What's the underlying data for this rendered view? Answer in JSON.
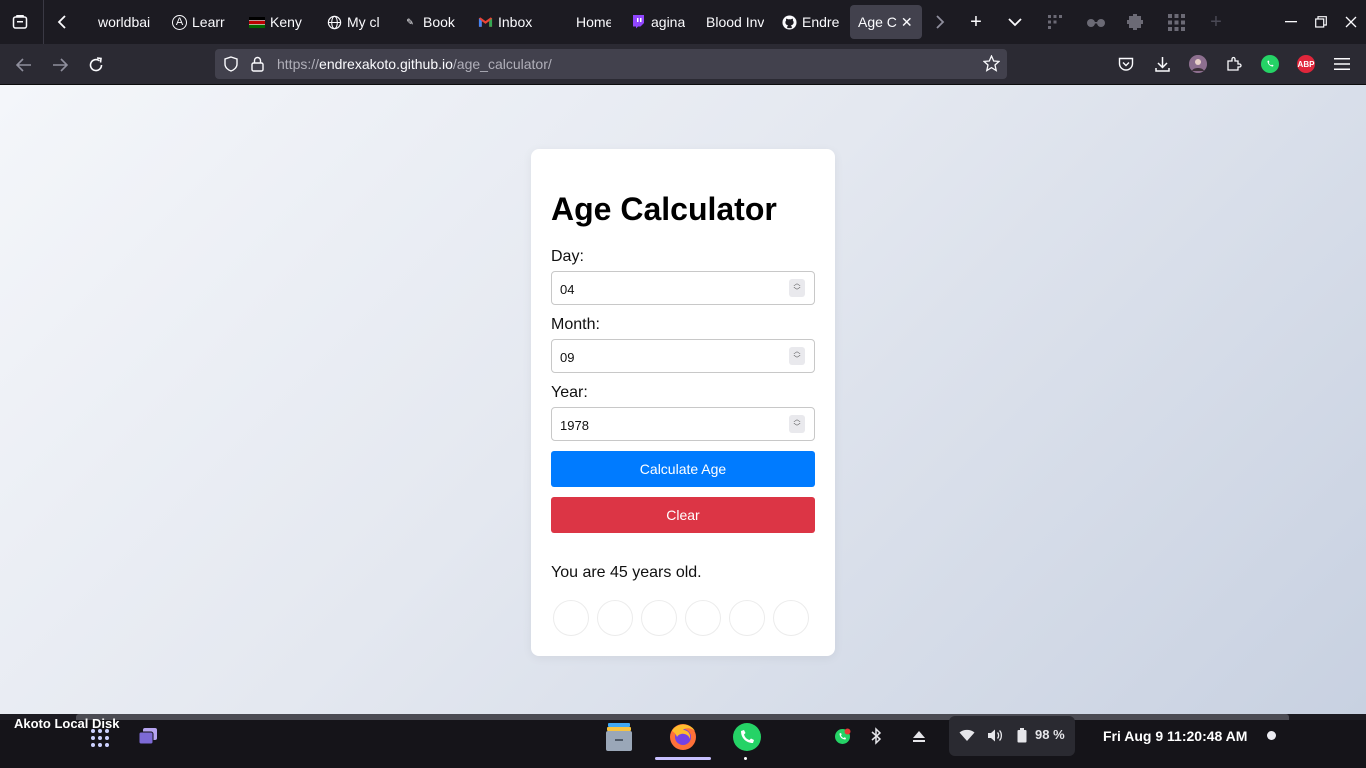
{
  "browser": {
    "tabs": [
      {
        "label": "worldbai",
        "icon": "globe-icon"
      },
      {
        "label": "Learr",
        "icon": "learn-icon"
      },
      {
        "label": "Keny",
        "icon": "kenya-flag-icon"
      },
      {
        "label": "My cl",
        "icon": "globe-icon"
      },
      {
        "label": "Book",
        "icon": "book-icon"
      },
      {
        "label": "Inbox",
        "icon": "gmail-icon"
      },
      {
        "label": "Home",
        "icon": "home-icon"
      },
      {
        "label": "agina",
        "icon": "twitch-icon"
      },
      {
        "label": "Blood Inv",
        "icon": "blood-icon"
      },
      {
        "label": "Endre",
        "icon": "github-icon"
      }
    ],
    "active_tab": {
      "label": "Age C"
    },
    "url_prefix": "https://",
    "url_domain": "endrexakoto.github.io",
    "url_path": "/age_calculator/",
    "extensions": {
      "adblock_label": "ABP"
    }
  },
  "page": {
    "title": "Age Calculator",
    "day_label": "Day:",
    "day_value": "04",
    "month_label": "Month:",
    "month_value": "09",
    "year_label": "Year:",
    "year_value": "1978",
    "calculate_label": "Calculate Age",
    "clear_label": "Clear",
    "result": "You are 45 years old."
  },
  "taskbar": {
    "disk_label": "Akoto Local Disk",
    "battery": "98 %",
    "clock": "Fri Aug 9  11:20:48 AM"
  },
  "colors": {
    "accent_blue": "#007bff",
    "danger_red": "#dc3545",
    "browser_dark": "#1c1b22"
  }
}
